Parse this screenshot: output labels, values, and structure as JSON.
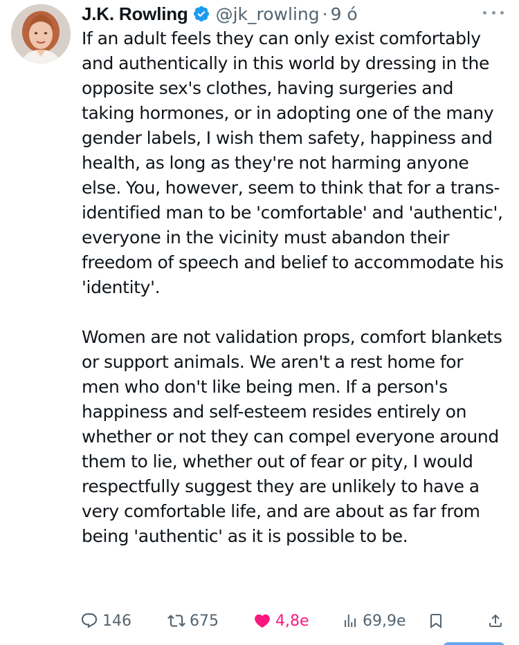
{
  "author": {
    "display_name": "J.K. Rowling",
    "handle": "@jk_rowling",
    "separator": "·",
    "time": "9 ó",
    "verified_color": "#1d9bf0"
  },
  "tweet": {
    "text": "If an adult feels they can only exist comfortably and authentically in this world by dressing in the opposite sex's clothes, having surgeries and taking hormones, or in adopting one of the many gender labels, I wish them safety, happiness and health, as long as they're not harming anyone else. You, however, seem to think that for a trans-identified man to be 'comfortable' and 'authentic', everyone in the vicinity must abandon their freedom of speech and belief to accommodate his 'identity'.\n\nWomen are not validation props, comfort blankets or support animals. We aren't a rest home for men who don't like being men. If a person's happiness and self-esteem resides entirely on whether or not they can compel everyone around them to lie, whether out of fear or pity, I would respectfully suggest they are unlikely to have a very comfortable life, and are about as far from being 'authentic' as it is possible to be."
  },
  "actions": {
    "replies": "146",
    "reposts": "675",
    "likes": "4,8e",
    "views": "69,9e",
    "like_color": "#f91880",
    "icon_color": "#536471"
  },
  "icons": {
    "more": "more-icon",
    "reply": "reply-icon",
    "repost": "repost-icon",
    "like": "heart-icon",
    "views": "views-icon",
    "bookmark": "bookmark-icon",
    "share": "share-icon",
    "verified": "verified-badge-icon"
  }
}
